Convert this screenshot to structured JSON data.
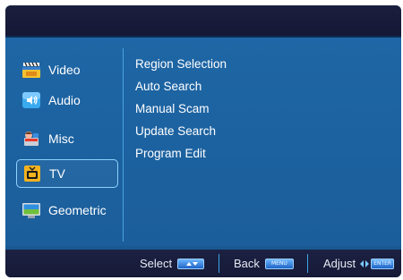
{
  "sidebar": {
    "items": [
      {
        "label": "Video",
        "icon": "film-clapper-icon"
      },
      {
        "label": "Audio",
        "icon": "speaker-icon"
      },
      {
        "label": "Misc",
        "icon": "misc-tools-icon"
      },
      {
        "label": "TV",
        "icon": "tv-icon",
        "selected": true
      },
      {
        "label": "Geometric",
        "icon": "monitor-geometry-icon"
      }
    ]
  },
  "menu": {
    "items": [
      "Region Selection",
      "Auto Search",
      "Manual Scam",
      "Update Search",
      "Program Edit"
    ]
  },
  "footer": {
    "select_label": "Select",
    "back_label": "Back",
    "back_key": "MENU",
    "adjust_label": "Adjust",
    "adjust_key": "ENTER"
  },
  "colors": {
    "panel": "#1d63a1",
    "bar": "#181c3b",
    "selection_border": "#8ed2ff",
    "text": "#ffffff"
  }
}
